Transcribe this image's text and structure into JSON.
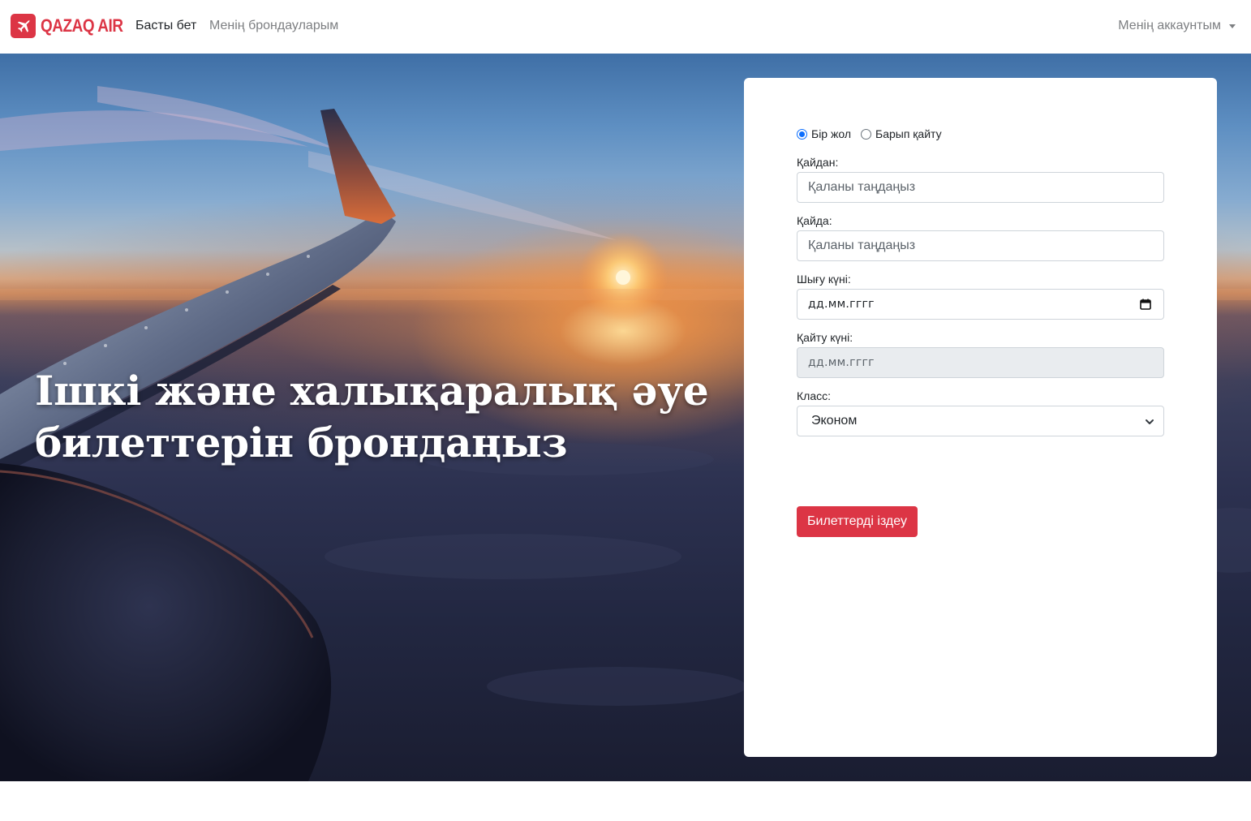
{
  "navbar": {
    "brand": "QAZAQ AIR",
    "links": [
      {
        "label": "Басты бет"
      },
      {
        "label": "Менің брондауларым"
      }
    ],
    "account_label": "Менің аккаунтым"
  },
  "hero": {
    "title": "Ішкі және халықаралық әуе билеттерін брондаңыз"
  },
  "form": {
    "trip_types": [
      {
        "label": "Бір жол",
        "checked": true
      },
      {
        "label": "Барып қайту",
        "checked": false
      }
    ],
    "from": {
      "label": "Қайдан:",
      "placeholder": "Қаланы таңдаңыз"
    },
    "to": {
      "label": "Қайда:",
      "placeholder": "Қаланы таңдаңыз"
    },
    "depart": {
      "label": "Шығу күні:",
      "value": "дд.мм.гггг"
    },
    "return": {
      "label": "Қайту күні:",
      "value": "дд.мм.гггг",
      "disabled": true
    },
    "class": {
      "label": "Класс:",
      "selected": "Эконом"
    },
    "submit_label": "Билеттерді іздеу"
  },
  "colors": {
    "accent": "#dc3545",
    "radio": "#0d6efd"
  },
  "icons": {
    "brand": "airplane-icon",
    "calendar": "calendar-icon",
    "dropdown": "chevron-down-icon"
  }
}
